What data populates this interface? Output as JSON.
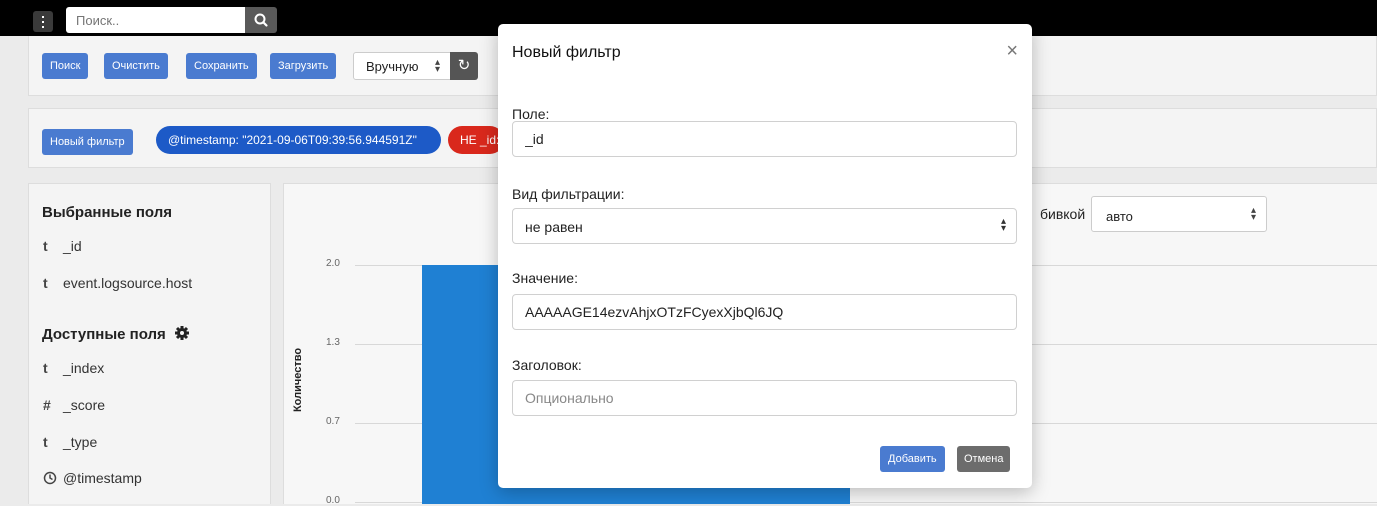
{
  "topbar": {
    "search_placeholder": "Поиск..",
    "search_icon": "search-icon",
    "menu_icon": "vertical-ellipsis-icon"
  },
  "toolbar": {
    "search_label": "Поиск",
    "clear_label": "Очистить",
    "save_label": "Сохранить",
    "load_label": "Загрузить",
    "refresh_mode": "Вручную",
    "refresh_icon": "refresh-icon"
  },
  "filters": {
    "new_filter_label": "Новый фильтр",
    "active": [
      {
        "text": "@timestamp: \"2021-09-06T09:39:56.944591Z\"",
        "color": "#1d5ac7"
      },
      {
        "text": "НЕ _id:",
        "color": "#d9281c"
      }
    ]
  },
  "sidebar": {
    "selected_title": "Выбранные поля",
    "selected_fields": [
      {
        "type": "t",
        "name": "_id"
      },
      {
        "type": "t",
        "name": "event.logsource.host"
      }
    ],
    "available_title": "Доступные поля",
    "available_icon": "gear-icon",
    "available_fields": [
      {
        "type": "t",
        "name": "_index"
      },
      {
        "type": "#",
        "name": "_score"
      },
      {
        "type": "t",
        "name": "_type"
      },
      {
        "type": "clock",
        "name": "@timestamp"
      }
    ]
  },
  "chart": {
    "interval_label_partial": "бивкой",
    "interval_value": "авто",
    "ylabel": "Количество",
    "yticks": [
      "2.0",
      "1.3",
      "0.7",
      "0.0"
    ],
    "bar_color": "#1f80d3"
  },
  "modal": {
    "title": "Новый фильтр",
    "close": "×",
    "field_label": "Поле:",
    "field_value": "_id",
    "filter_type_label": "Вид фильтрации:",
    "filter_type_value": "не равен",
    "value_label": "Значение:",
    "value_value": "AAAAAGE14ezvAhjxOTzFCyexXjbQl6JQ",
    "header_label": "Заголовок:",
    "header_placeholder": "Опционально",
    "add_label": "Добавить",
    "cancel_label": "Отмена",
    "accent": "#4a7bd0"
  }
}
